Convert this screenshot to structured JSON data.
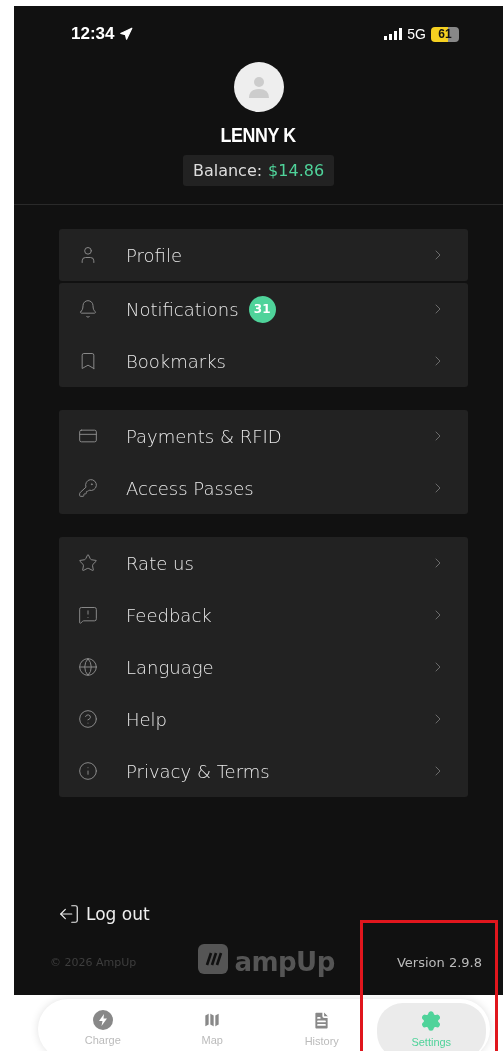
{
  "status_bar": {
    "time": "12:34",
    "network": "5G",
    "battery": "61"
  },
  "profile": {
    "name": "LENNY K",
    "balance_label": "Balance:",
    "balance_amount": "$14.86"
  },
  "menu_groups": [
    {
      "cards": [
        [
          {
            "label": "Profile"
          }
        ],
        [
          {
            "label": "Notifications",
            "badge": "31"
          },
          {
            "label": "Bookmarks"
          }
        ]
      ]
    },
    {
      "cards": [
        [
          {
            "label": "Payments & RFID"
          },
          {
            "label": "Access Passes"
          }
        ]
      ]
    },
    {
      "cards": [
        [
          {
            "label": "Rate us"
          },
          {
            "label": "Feedback"
          },
          {
            "label": "Language"
          },
          {
            "label": "Help"
          },
          {
            "label": "Privacy & Terms"
          }
        ]
      ]
    }
  ],
  "logout": "Log out",
  "footer": {
    "copyright": "© 2026 AmpUp",
    "logo": "ampUp",
    "version": "Version 2.9.8"
  },
  "tabs": [
    {
      "label": "Charge",
      "selected": false
    },
    {
      "label": "Map",
      "selected": false
    },
    {
      "label": "History",
      "selected": false
    },
    {
      "label": "Settings",
      "selected": true
    }
  ]
}
